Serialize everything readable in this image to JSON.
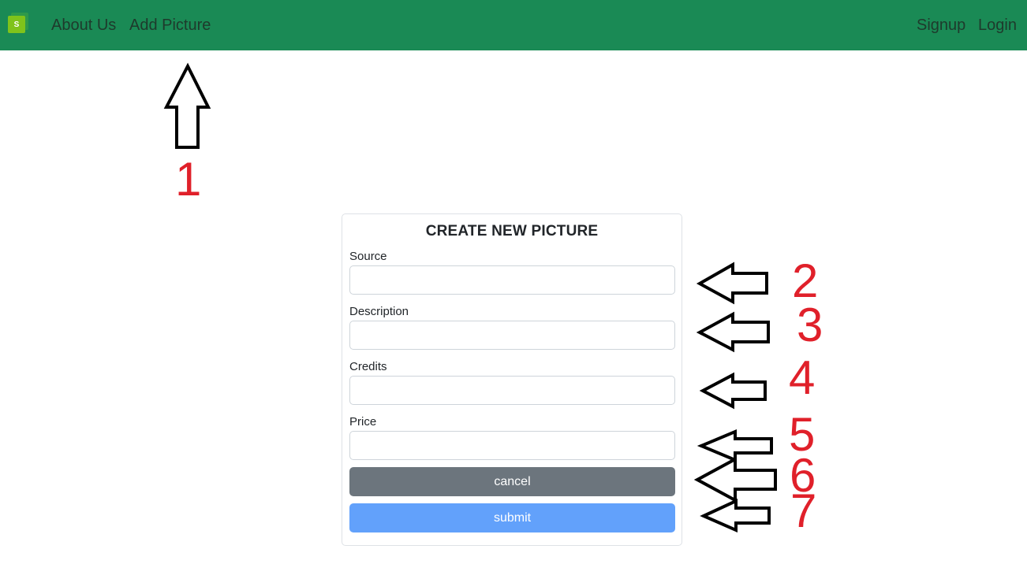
{
  "navbar": {
    "logo_text": "S",
    "links_left": [
      "About Us",
      "Add Picture"
    ],
    "links_right": [
      "Signup",
      "Login"
    ],
    "color": "#1a8a55"
  },
  "form": {
    "title": "CREATE NEW PICTURE",
    "fields": [
      {
        "label": "Source",
        "value": ""
      },
      {
        "label": "Description",
        "value": ""
      },
      {
        "label": "Credits",
        "value": ""
      },
      {
        "label": "Price",
        "value": ""
      }
    ],
    "cancel_label": "cancel",
    "submit_label": "submit"
  },
  "annotations": {
    "arrow_icon": "outline-arrow-icon",
    "numbers": [
      "1",
      "2",
      "3",
      "4",
      "5",
      "6",
      "7"
    ],
    "color": "#e0202a"
  }
}
